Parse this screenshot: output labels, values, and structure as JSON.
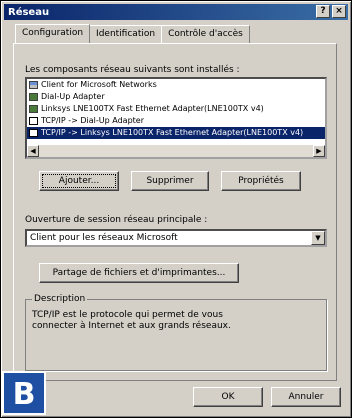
{
  "window": {
    "title": "Réseau"
  },
  "titlebar_buttons": {
    "help": "?",
    "close": "×"
  },
  "tabs": [
    {
      "label": "Configuration"
    },
    {
      "label": "Identification"
    },
    {
      "label": "Contrôle d'accès"
    }
  ],
  "components": {
    "label": "Les composants réseau suivants sont installés :",
    "items": [
      {
        "label": "Client for Microsoft Networks",
        "icon": "client-icon"
      },
      {
        "label": "Dial-Up Adapter",
        "icon": "adapter-icon"
      },
      {
        "label": "Linksys LNE100TX Fast Ethernet Adapter(LNE100TX v4)",
        "icon": "adapter-icon"
      },
      {
        "label": "TCP/IP -> Dial-Up Adapter",
        "icon": "protocol-icon"
      },
      {
        "label": "TCP/IP -> Linksys LNE100TX Fast Ethernet Adapter(LNE100TX v4)",
        "icon": "protocol-icon",
        "selected": true
      }
    ]
  },
  "buttons": {
    "add": "Ajouter...",
    "remove": "Supprimer",
    "properties": "Propriétés",
    "file_sharing": "Partage de fichiers et d'imprimantes...",
    "ok": "OK",
    "cancel": "Annuler"
  },
  "logon": {
    "label": "Ouverture de session réseau principale :",
    "value": "Client pour les réseaux Microsoft"
  },
  "description": {
    "title": "Description",
    "text": "TCP/IP est le protocole qui permet de vous connecter à Internet et aux grands réseaux."
  },
  "overlay_badge": "B",
  "colors": {
    "dialog_face": "#d4d0c8",
    "titlebar": "#0a246a",
    "selection": "#0a246a",
    "badge": "#1e4fa3"
  }
}
